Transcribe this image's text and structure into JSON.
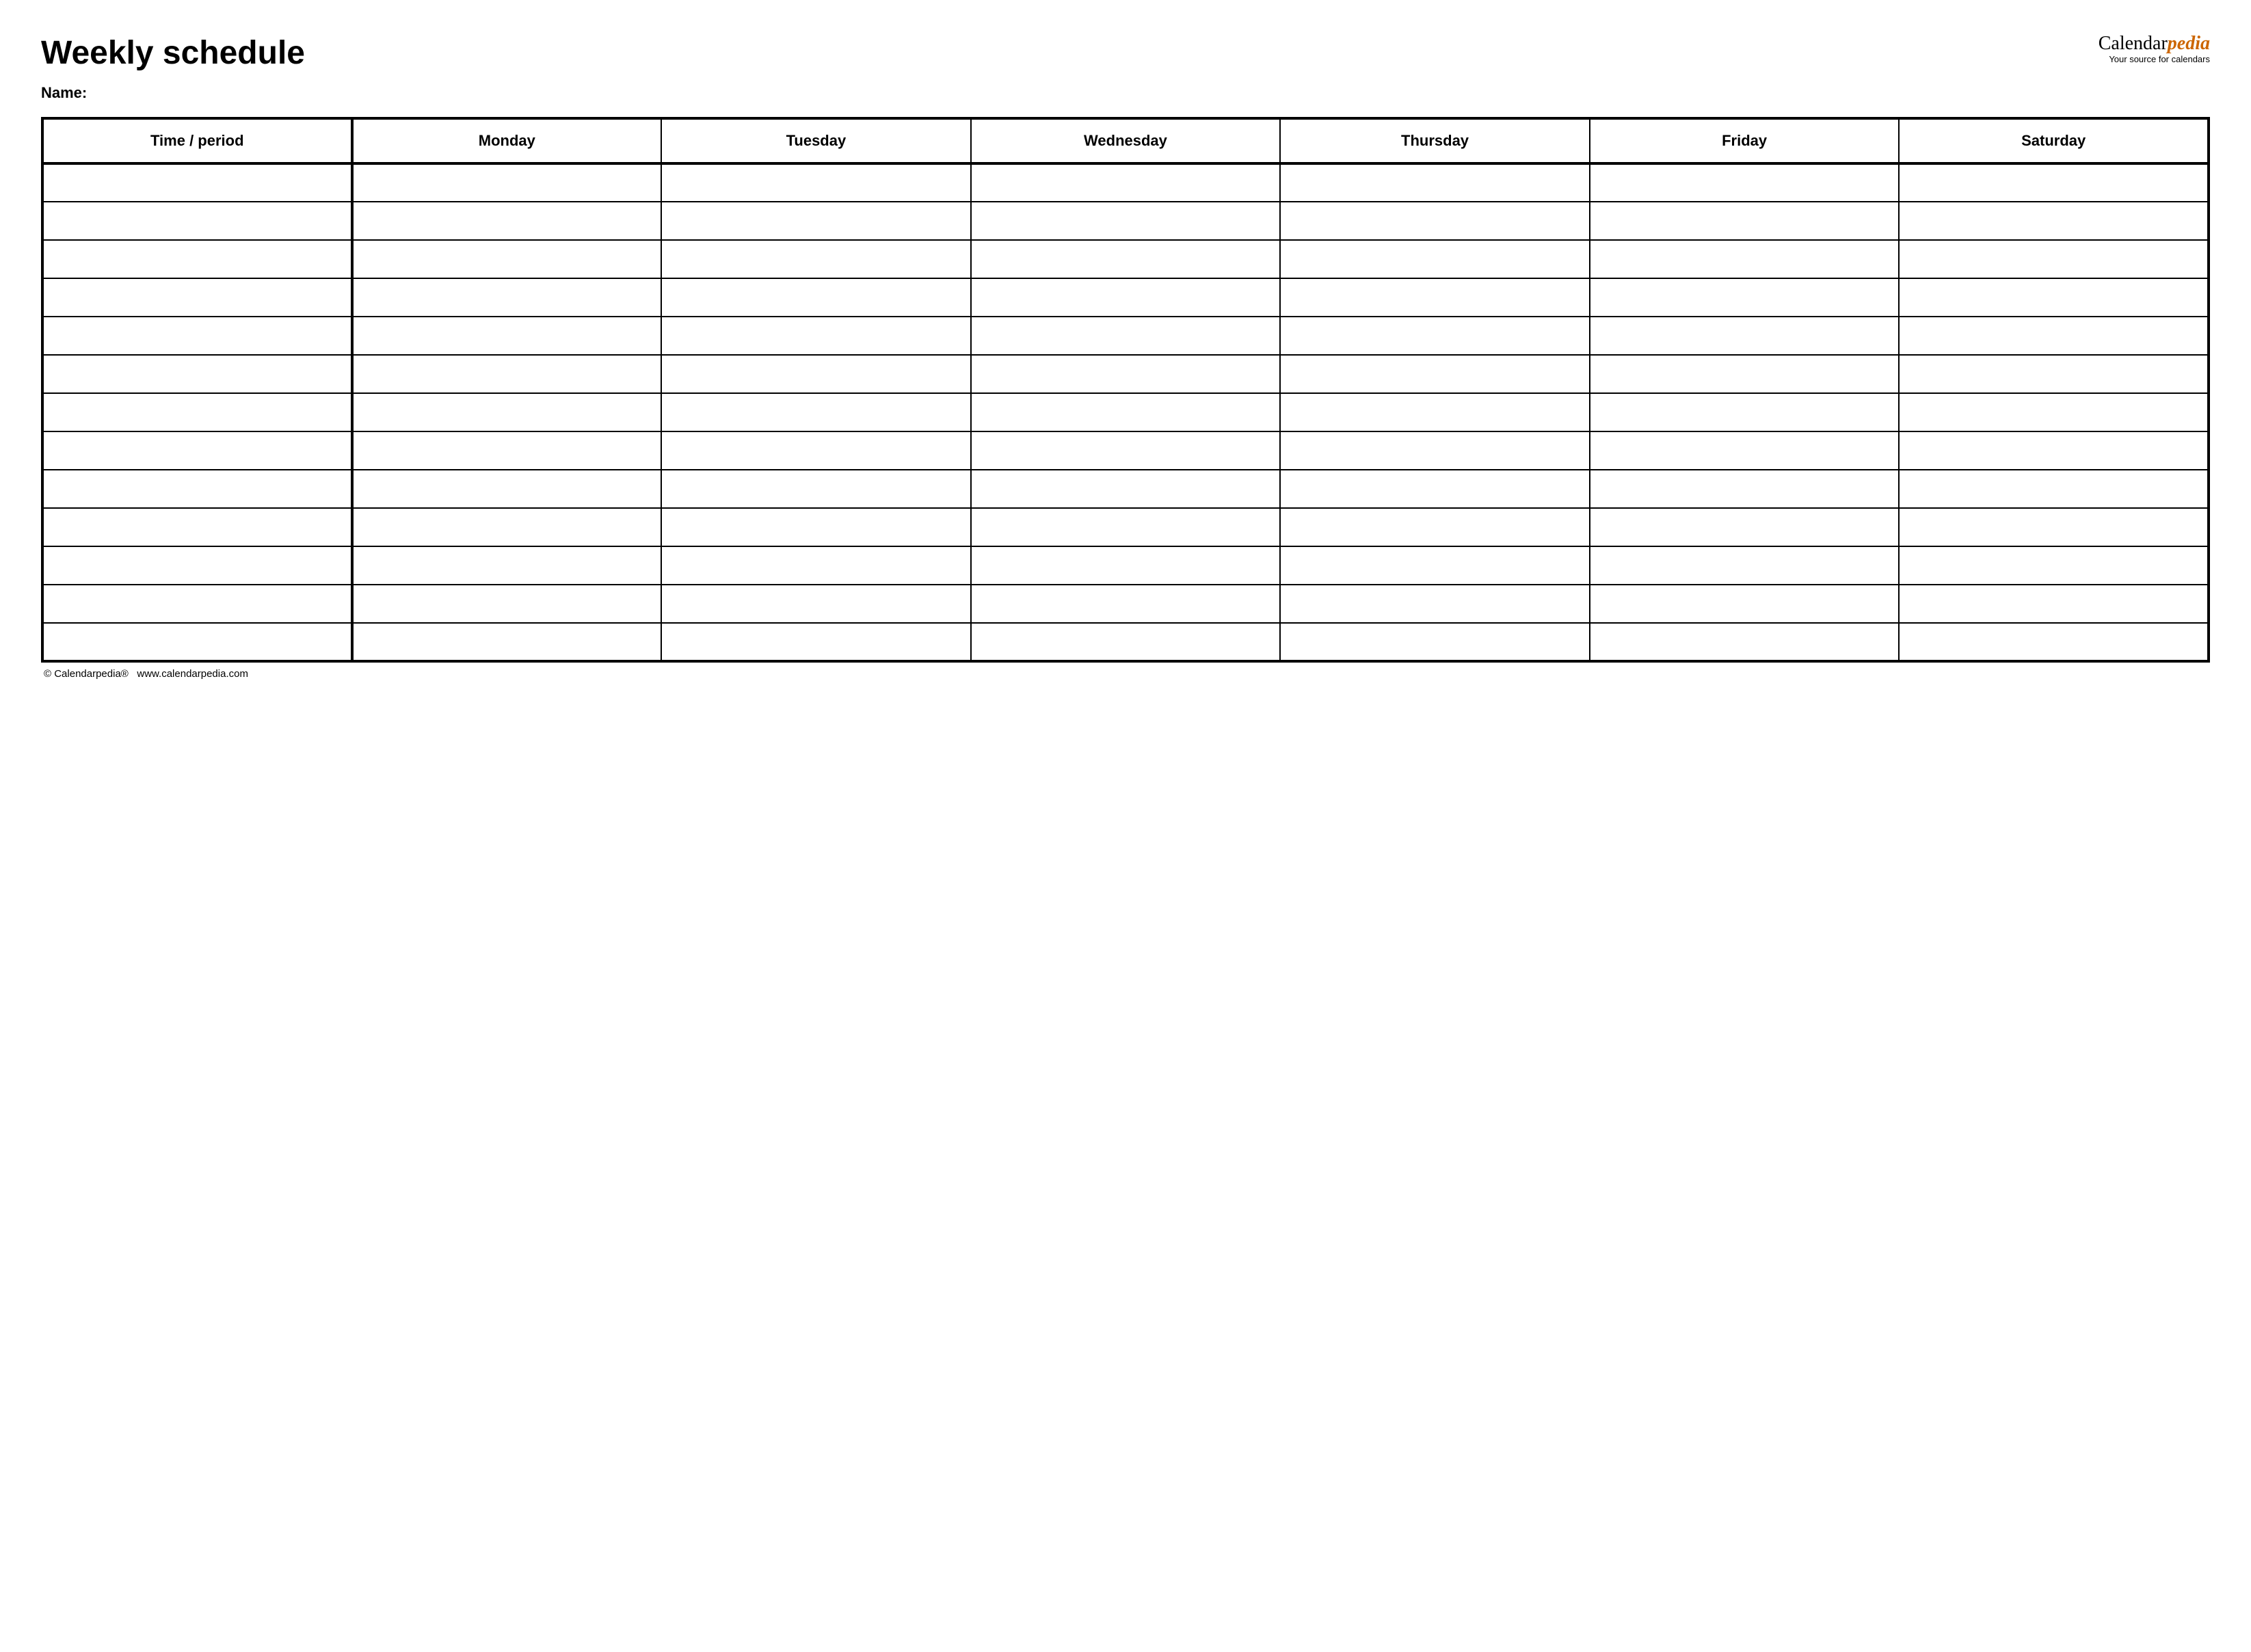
{
  "header": {
    "title": "Weekly schedule",
    "brand_prefix": "Calendar",
    "brand_accent": "pedia",
    "brand_tagline": "Your source for calendars"
  },
  "name_label": "Name:",
  "columns": [
    "Time / period",
    "Monday",
    "Tuesday",
    "Wednesday",
    "Thursday",
    "Friday",
    "Saturday"
  ],
  "row_count": 13,
  "footer": {
    "copyright": "© Calendarpedia®",
    "website": "www.calendarpedia.com"
  }
}
